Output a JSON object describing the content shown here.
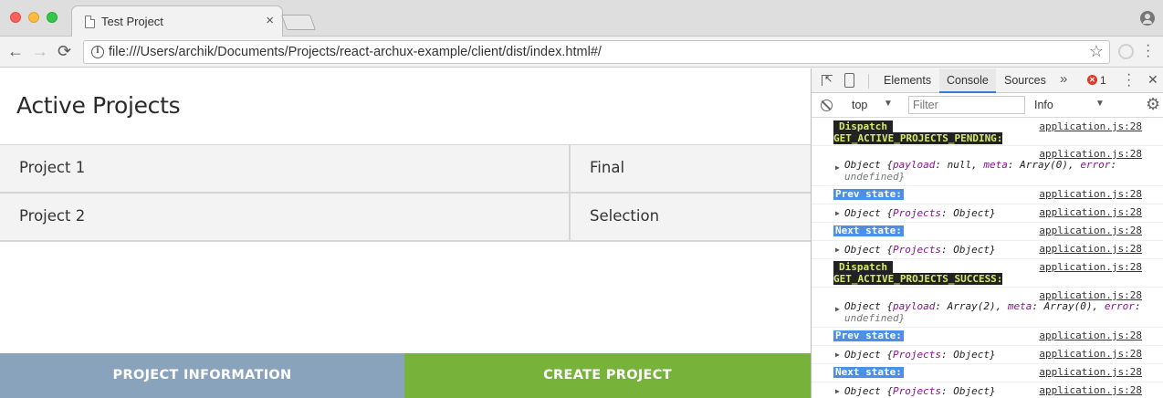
{
  "browser": {
    "tab_title": "Test Project",
    "tab_close": "×",
    "url": "file:///Users/archik/Documents/Projects/react-archux-example/client/dist/index.html#/",
    "back": "←",
    "forward": "→",
    "reload": "⟳",
    "star": "☆",
    "info": "i"
  },
  "page": {
    "title": "Active Projects",
    "projects": [
      {
        "name": "Project 1",
        "stage": "Final"
      },
      {
        "name": "Project 2",
        "stage": "Selection"
      }
    ],
    "buttons": {
      "info": "PROJECT INFORMATION",
      "create": "CREATE PROJECT"
    },
    "colors": {
      "info_button": "#8aa3bd",
      "create_button": "#77b33a"
    }
  },
  "devtools": {
    "tabs": [
      "Elements",
      "Console",
      "Sources"
    ],
    "active_tab": "Console",
    "more": "»",
    "error_count": "1",
    "close": "✕",
    "context": "top",
    "filter_placeholder": "Filter",
    "level": "Info",
    "arrow": "▼",
    "gear": "⚙",
    "disclosure": "▶",
    "source": "application.js:28",
    "logs": {
      "d1": {
        "label": "Dispatch",
        "action": "GET_ACTIVE_PROJECTS_PENDING:"
      },
      "o1": {
        "p1": "Object {",
        "k1": "payload",
        "p2": ": null, ",
        "k2": "meta",
        "p3": ": Array(0), ",
        "k3": "error",
        "p4": ":",
        "p5": "undefined}"
      },
      "prev1": "Prev state:",
      "o2": {
        "p1": "Object {",
        "k1": "Projects",
        "p2": ": Object}"
      },
      "next1": "Next state:",
      "o3": {
        "p1": "Object {",
        "k1": "Projects",
        "p2": ": Object}"
      },
      "d2": {
        "label": "Dispatch",
        "action": "GET_ACTIVE_PROJECTS_SUCCESS:"
      },
      "o4": {
        "p1": "Object {",
        "k1": "payload",
        "p2": ": Array(2), ",
        "k2": "meta",
        "p3": ": Array(0), ",
        "k3": "error",
        "p4": ":",
        "p5": "undefined}"
      },
      "prev2": "Prev state:",
      "o5": {
        "p1": "Object {",
        "k1": "Projects",
        "p2": ": Object}"
      },
      "next2": "Next state:",
      "o6": {
        "p1": "Object {",
        "k1": "Projects",
        "p2": ": Object}"
      }
    }
  }
}
